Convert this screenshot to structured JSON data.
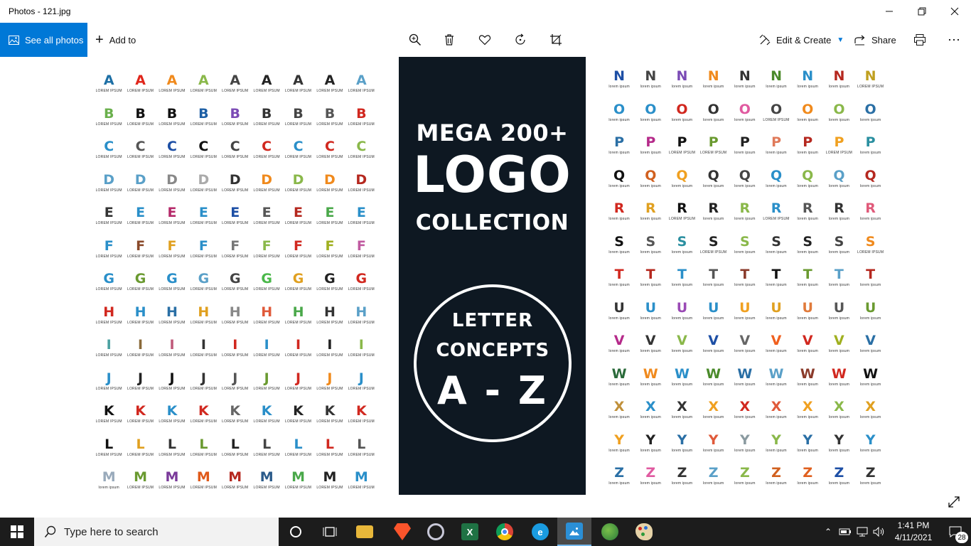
{
  "window": {
    "title": "Photos - 121.jpg",
    "minimize_icon": "minimize-icon",
    "maximize_icon": "restore-icon",
    "close_icon": "close-icon"
  },
  "toolbar": {
    "see_all_label": "See all photos",
    "add_to_label": "Add to",
    "edit_create_label": "Edit & Create",
    "share_label": "Share",
    "icons": [
      "zoom-icon",
      "delete-icon",
      "favorite-icon",
      "rotate-icon",
      "crop-icon",
      "print-icon",
      "more-icon"
    ],
    "accent": "#0078d7"
  },
  "photo": {
    "panel": {
      "line1": "MEGA 200+",
      "line2": "LOGO",
      "line3": "COLLECTION",
      "circle_line1": "LETTER",
      "circle_line2": "CONCEPTS",
      "circle_line3": "A - Z",
      "background": "#0e1822"
    },
    "left_rows": [
      {
        "letter": "A",
        "captions": [
          "LOREM IPSUM",
          "LOREM IPSUM",
          "LOREM IPSUM",
          "LOREM IPSUM",
          "LOREM IPSUM",
          "LOREM IPSUM",
          "LOREM IPSUM",
          "LOREM IPSUM",
          "LOREM IPSUM"
        ],
        "colors": [
          "#1d6fa5",
          "#e0261b",
          "#f08a1d",
          "#8ab84a",
          "#444",
          "#222",
          "#333",
          "#222",
          "#5aa0c8"
        ]
      },
      {
        "letter": "B",
        "captions": [
          "LOREM IPSUM",
          "LOREM IPSUM",
          "LOREM IPSUM",
          "LOREM IPSUM",
          "LOREM IPSUM",
          "LOREM IPSUM",
          "LOREM IPSUM",
          "LOREM IPSUM",
          "LOREM IPSUM"
        ],
        "colors": [
          "#6ab04c",
          "#111",
          "#111",
          "#1d5fa5",
          "#7b4bb5",
          "#333",
          "#444",
          "#555",
          "#d1281f"
        ]
      },
      {
        "letter": "C",
        "captions": [
          "LOREM IPSUM",
          "LOREM IPSUM",
          "LOREM IPSUM",
          "LOREM IPSUM",
          "LOREM IPSUM",
          "LOREM IPSUM",
          "LOREM IPSUM",
          "LOREM IPSUM",
          "LOREM IPSUM"
        ],
        "colors": [
          "#2a8fc9",
          "#555",
          "#1d4fa5",
          "#111",
          "#444",
          "#d1281f",
          "#2a8fc9",
          "#d1281f",
          "#8ab84a"
        ]
      },
      {
        "letter": "D",
        "captions": [
          "LOREM IPSUM",
          "LOREM IPSUM",
          "LOREM IPSUM",
          "LOREM IPSUM",
          "LOREM IPSUM",
          "LOREM IPSUM",
          "LOREM IPSUM",
          "LOREM IPSUM",
          "LOREM IPSUM"
        ],
        "colors": [
          "#5aa0c8",
          "#5aa0c8",
          "#888",
          "#aaa",
          "#333",
          "#f08a1d",
          "#8ab84a",
          "#f08a1d",
          "#b5281f"
        ]
      },
      {
        "letter": "E",
        "captions": [
          "LOREM IPSUM",
          "LOREM IPSUM",
          "LOREM IPSUM",
          "LOREM IPSUM",
          "LOREM IPSUM",
          "LOREM IPSUM",
          "LOREM IPSUM",
          "LOREM IPSUM",
          "LOREM IPSUM"
        ],
        "colors": [
          "#333",
          "#2a8fc9",
          "#b52a6a",
          "#2a8fc9",
          "#1d4fa5",
          "#555",
          "#b5281f",
          "#4aa84a",
          "#2a8fc9"
        ]
      },
      {
        "letter": "F",
        "captions": [
          "LOREM IPSUM",
          "LOREM IPSUM",
          "LOREM IPSUM",
          "LOREM IPSUM",
          "LOREM IPSUM",
          "LOREM IPSUM",
          "LOREM IPSUM",
          "LOREM IPSUM",
          "LOREM IPSUM"
        ],
        "colors": [
          "#2a8fc9",
          "#8a4a2a",
          "#e0a020",
          "#2a8fc9",
          "#777",
          "#8ab84a",
          "#d1281f",
          "#a0b020",
          "#c05aa0"
        ]
      },
      {
        "letter": "G",
        "captions": [
          "LOREM IPSUM",
          "LOREM IPSUM",
          "LOREM IPSUM",
          "LOREM IPSUM",
          "LOREM IPSUM",
          "LOREM IPSUM",
          "LOREM IPSUM",
          "LOREM IPSUM",
          "LOREM IPSUM"
        ],
        "colors": [
          "#2a8fc9",
          "#6a9a30",
          "#2a8fc9",
          "#5aa0c8",
          "#444",
          "#4ab84a",
          "#e0a020",
          "#222",
          "#d1281f"
        ]
      },
      {
        "letter": "H",
        "captions": [
          "LOREM IPSUM",
          "LOREM IPSUM",
          "LOREM IPSUM",
          "LOREM IPSUM",
          "LOREM IPSUM",
          "LOREM IPSUM",
          "LOREM IPSUM",
          "LOREM IPSUM",
          "LOREM IPSUM"
        ],
        "colors": [
          "#d1281f",
          "#2a8fc9",
          "#2a6fa5",
          "#e0a020",
          "#888",
          "#e05a3a",
          "#4aa84a",
          "#333",
          "#5aa0c8"
        ]
      },
      {
        "letter": "I",
        "captions": [
          "LOREM IPSUM",
          "LOREM IPSUM",
          "LOREM IPSUM",
          "LOREM IPSUM",
          "LOREM IPSUM",
          "LOREM IPSUM",
          "LOREM IPSUM",
          "LOREM IPSUM",
          "LOREM IPSUM"
        ],
        "colors": [
          "#4aa0a0",
          "#8a6a3a",
          "#c05a7a",
          "#333",
          "#d1281f",
          "#2a8fc9",
          "#d1281f",
          "#222",
          "#8ab84a"
        ]
      },
      {
        "letter": "J",
        "captions": [
          "LOREM IPSUM",
          "LOREM IPSUM",
          "LOREM IPSUM",
          "LOREM IPSUM",
          "LOREM IPSUM",
          "LOREM IPSUM",
          "LOREM IPSUM",
          "LOREM IPSUM",
          "LOREM IPSUM"
        ],
        "colors": [
          "#2a8fc9",
          "#222",
          "#111",
          "#333",
          "#555",
          "#6a9a30",
          "#d1281f",
          "#f08a1d",
          "#2a8fc9"
        ]
      },
      {
        "letter": "K",
        "captions": [
          "LOREM IPSUM",
          "LOREM IPSUM",
          "LOREM IPSUM",
          "LOREM IPSUM",
          "LOREM IPSUM",
          "LOREM IPSUM",
          "LOREM IPSUM",
          "LOREM IPSUM",
          "LOREM IPSUM"
        ],
        "colors": [
          "#111",
          "#d1281f",
          "#2a8fc9",
          "#d1281f",
          "#666",
          "#2a8fc9",
          "#222",
          "#333",
          "#d1281f"
        ]
      },
      {
        "letter": "L",
        "captions": [
          "LOREM IPSUM",
          "LOREM IPSUM",
          "LOREM IPSUM",
          "LOREM IPSUM",
          "LOREM IPSUM",
          "LOREM IPSUM",
          "LOREM IPSUM",
          "LOREM IPSUM",
          "LOREM IPSUM"
        ],
        "colors": [
          "#111",
          "#e0a020",
          "#333",
          "#6a9a30",
          "#222",
          "#444",
          "#2a8fc9",
          "#d1281f",
          "#555"
        ]
      },
      {
        "letter": "M",
        "captions": [
          "lorem ipsum",
          "LOREM IPSUM",
          "LOREM IPSUM",
          "LOREM IPSUM",
          "LOREM IPSUM",
          "LOREM IPSUM",
          "LOREM IPSUM",
          "LOREM IPSUM",
          "LOREM IPSUM"
        ],
        "colors": [
          "#9ab",
          "#6a9a30",
          "#7a3a9a",
          "#e05a1a",
          "#b5281f",
          "#2a5a8a",
          "#4aa84a",
          "#222",
          "#2a8fc9"
        ]
      }
    ],
    "right_rows": [
      {
        "letter": "N",
        "captions": [
          "lorem ipsum",
          "lorem ipsum",
          "lorem ipsum",
          "lorem ipsum",
          "lorem ipsum",
          "lorem ipsum",
          "lorem ipsum",
          "lorem ipsum",
          "LOREM IPSUM"
        ],
        "colors": [
          "#1d4fa5",
          "#444",
          "#7a4ab5",
          "#f08a1d",
          "#333",
          "#4a8a2a",
          "#2a8fc9",
          "#b5281f",
          "#c0a020"
        ]
      },
      {
        "letter": "O",
        "captions": [
          "lorem ipsum",
          "lorem ipsum",
          "lorem ipsum",
          "lorem ipsum",
          "lorem ipsum",
          "LOREM IPSUM",
          "lorem ipsum",
          "lorem ipsum",
          "lorem ipsum"
        ],
        "colors": [
          "#2a8fc9",
          "#2a8fc9",
          "#d1281f",
          "#333",
          "#e05aa0",
          "#444",
          "#f08a1d",
          "#8ab84a",
          "#2a6fa5"
        ]
      },
      {
        "letter": "P",
        "captions": [
          "lorem ipsum",
          "lorem ipsum",
          "LOREM IPSUM",
          "LOREM IPSUM",
          "lorem ipsum",
          "lorem ipsum",
          "lorem ipsum",
          "LOREM IPSUM",
          "lorem ipsum"
        ],
        "colors": [
          "#2a6fa5",
          "#b52a8a",
          "#111",
          "#6a9a30",
          "#222",
          "#e07a5a",
          "#b5281f",
          "#f0a020",
          "#2a8fa0"
        ]
      },
      {
        "letter": "Q",
        "captions": [
          "lorem ipsum",
          "lorem ipsum",
          "lorem ipsum",
          "lorem ipsum",
          "lorem ipsum",
          "lorem ipsum",
          "lorem ipsum",
          "lorem ipsum",
          "lorem ipsum"
        ],
        "colors": [
          "#111",
          "#d1601f",
          "#f0a020",
          "#333",
          "#444",
          "#2a8fc9",
          "#8ab84a",
          "#5aa0c8",
          "#b5281f"
        ]
      },
      {
        "letter": "R",
        "captions": [
          "lorem ipsum",
          "lorem ipsum",
          "LOREM IPSUM",
          "lorem ipsum",
          "lorem ipsum",
          "LOREM IPSUM",
          "lorem ipsum",
          "lorem ipsum",
          "lorem ipsum"
        ],
        "colors": [
          "#d1281f",
          "#e0a020",
          "#111",
          "#222",
          "#8ab84a",
          "#2a8fc9",
          "#555",
          "#333",
          "#e05a7a"
        ]
      },
      {
        "letter": "S",
        "captions": [
          "lorem ipsum",
          "lorem ipsum",
          "lorem ipsum",
          "LOREM IPSUM",
          "lorem ipsum",
          "lorem ipsum",
          "lorem ipsum",
          "lorem ipsum",
          "LOREM IPSUM"
        ],
        "colors": [
          "#111",
          "#555",
          "#2a8fa0",
          "#222",
          "#8ab84a",
          "#333",
          "#222",
          "#444",
          "#f08a1d"
        ]
      },
      {
        "letter": "T",
        "captions": [
          "lorem ipsum",
          "lorem ipsum",
          "lorem ipsum",
          "lorem ipsum",
          "lorem ipsum",
          "lorem ipsum",
          "lorem ipsum",
          "lorem ipsum",
          "lorem ipsum"
        ],
        "colors": [
          "#d1281f",
          "#b5281f",
          "#2a8fc9",
          "#555",
          "#8a3a2a",
          "#111",
          "#6a9a30",
          "#5aa0c8",
          "#b5281f"
        ]
      },
      {
        "letter": "U",
        "captions": [
          "lorem ipsum",
          "lorem ipsum",
          "lorem ipsum",
          "lorem ipsum",
          "lorem ipsum",
          "lorem ipsum",
          "lorem ipsum",
          "lorem ipsum",
          "lorem ipsum"
        ],
        "colors": [
          "#333",
          "#2a8fc9",
          "#9a4ab5",
          "#2a8fc9",
          "#f0a020",
          "#e0a020",
          "#e07a3a",
          "#555",
          "#6a9a30"
        ]
      },
      {
        "letter": "V",
        "captions": [
          "lorem ipsum",
          "lorem ipsum",
          "lorem ipsum",
          "lorem ipsum",
          "lorem ipsum",
          "lorem ipsum",
          "lorem ipsum",
          "lorem ipsum",
          "lorem ipsum"
        ],
        "colors": [
          "#b52a8a",
          "#333",
          "#8ab84a",
          "#1d4fa5",
          "#666",
          "#f0601f",
          "#d1281f",
          "#a0b020",
          "#2a6fa5"
        ]
      },
      {
        "letter": "W",
        "captions": [
          "lorem ipsum",
          "lorem ipsum",
          "lorem ipsum",
          "lorem ipsum",
          "lorem ipsum",
          "lorem ipsum",
          "lorem ipsum",
          "lorem ipsum",
          "lorem ipsum"
        ],
        "colors": [
          "#2a6a3a",
          "#f08a1d",
          "#2a8fc9",
          "#4a8a2a",
          "#2a6fa5",
          "#5aa0c8",
          "#8a3a2a",
          "#d1281f",
          "#111"
        ]
      },
      {
        "letter": "X",
        "captions": [
          "lorem ipsum",
          "lorem ipsum",
          "lorem ipsum",
          "lorem ipsum",
          "lorem ipsum",
          "lorem ipsum",
          "lorem ipsum",
          "lorem ipsum",
          "lorem ipsum"
        ],
        "colors": [
          "#c0903a",
          "#2a8fc9",
          "#333",
          "#f0a020",
          "#d1281f",
          "#e05a3a",
          "#f0a020",
          "#8ab84a",
          "#e0a020"
        ]
      },
      {
        "letter": "Y",
        "captions": [
          "lorem ipsum",
          "lorem ipsum",
          "lorem ipsum",
          "lorem ipsum",
          "lorem ipsum",
          "lorem ipsum",
          "lorem ipsum",
          "lorem ipsum",
          "lorem ipsum"
        ],
        "colors": [
          "#f0a020",
          "#222",
          "#2a6fa5",
          "#e05a3a",
          "#8a9aa0",
          "#8ab84a",
          "#2a6fa5",
          "#333",
          "#2a8fc9"
        ]
      },
      {
        "letter": "Z",
        "captions": [
          "lorem ipsum",
          "lorem ipsum",
          "lorem ipsum",
          "lorem ipsum",
          "lorem ipsum",
          "lorem ipsum",
          "lorem ipsum",
          "lorem ipsum",
          "lorem ipsum"
        ],
        "colors": [
          "#2a6fa5",
          "#e05aa0",
          "#333",
          "#5aa0c8",
          "#8ab84a",
          "#d1601f",
          "#e0601f",
          "#1d4fa5",
          "#333"
        ]
      }
    ],
    "expand_icon": "expand-icon"
  },
  "taskbar": {
    "search_placeholder": "Type here to search",
    "apps": [
      "cortana-icon",
      "task-view-icon",
      "file-explorer-icon",
      "brave-browser-icon",
      "app-icon",
      "excel-icon",
      "chrome-icon",
      "edge-icon",
      "photos-icon",
      "map-app-icon",
      "paint-icon"
    ],
    "time": "1:41 PM",
    "date": "4/11/2021",
    "notification_count": "28"
  }
}
